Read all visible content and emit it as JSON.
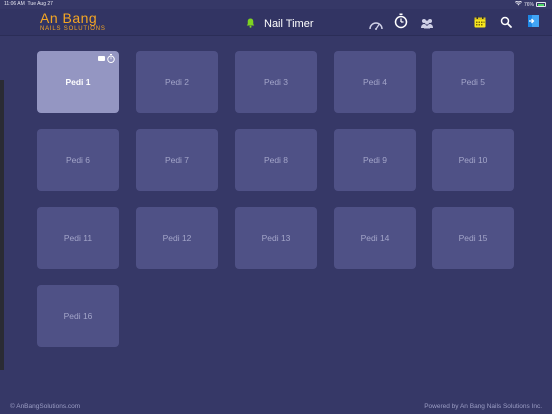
{
  "status_bar": {
    "time": "11:06 AM",
    "date": "Tue Aug 27",
    "battery": "76%"
  },
  "header": {
    "logo_line1": "An Bang",
    "logo_line2": "NAILS SOLUTIONS",
    "title": "Nail Timer",
    "icons": [
      "bell-icon",
      "speedometer-icon",
      "timer-icon",
      "group-icon",
      "calendar-icon",
      "search-icon",
      "exit-icon"
    ]
  },
  "stations": [
    {
      "label": "Pedi 1",
      "active": true
    },
    {
      "label": "Pedi 2",
      "active": false
    },
    {
      "label": "Pedi 3",
      "active": false
    },
    {
      "label": "Pedi 4",
      "active": false
    },
    {
      "label": "Pedi 5",
      "active": false
    },
    {
      "label": "Pedi 6",
      "active": false
    },
    {
      "label": "Pedi 7",
      "active": false
    },
    {
      "label": "Pedi 8",
      "active": false
    },
    {
      "label": "Pedi 9",
      "active": false
    },
    {
      "label": "Pedi 10",
      "active": false
    },
    {
      "label": "Pedi 11",
      "active": false
    },
    {
      "label": "Pedi 12",
      "active": false
    },
    {
      "label": "Pedi 13",
      "active": false
    },
    {
      "label": "Pedi 14",
      "active": false
    },
    {
      "label": "Pedi 15",
      "active": false
    },
    {
      "label": "Pedi 16",
      "active": false
    }
  ],
  "footer": {
    "left": "© AnBangSolutions.com",
    "right": "Powered by An Bang Nails Solutions Inc."
  },
  "colors": {
    "background": "#363867",
    "tile": "#4f5186",
    "tile_active": "#9496c2",
    "accent": "#f5a623",
    "bell": "#7ed321"
  }
}
